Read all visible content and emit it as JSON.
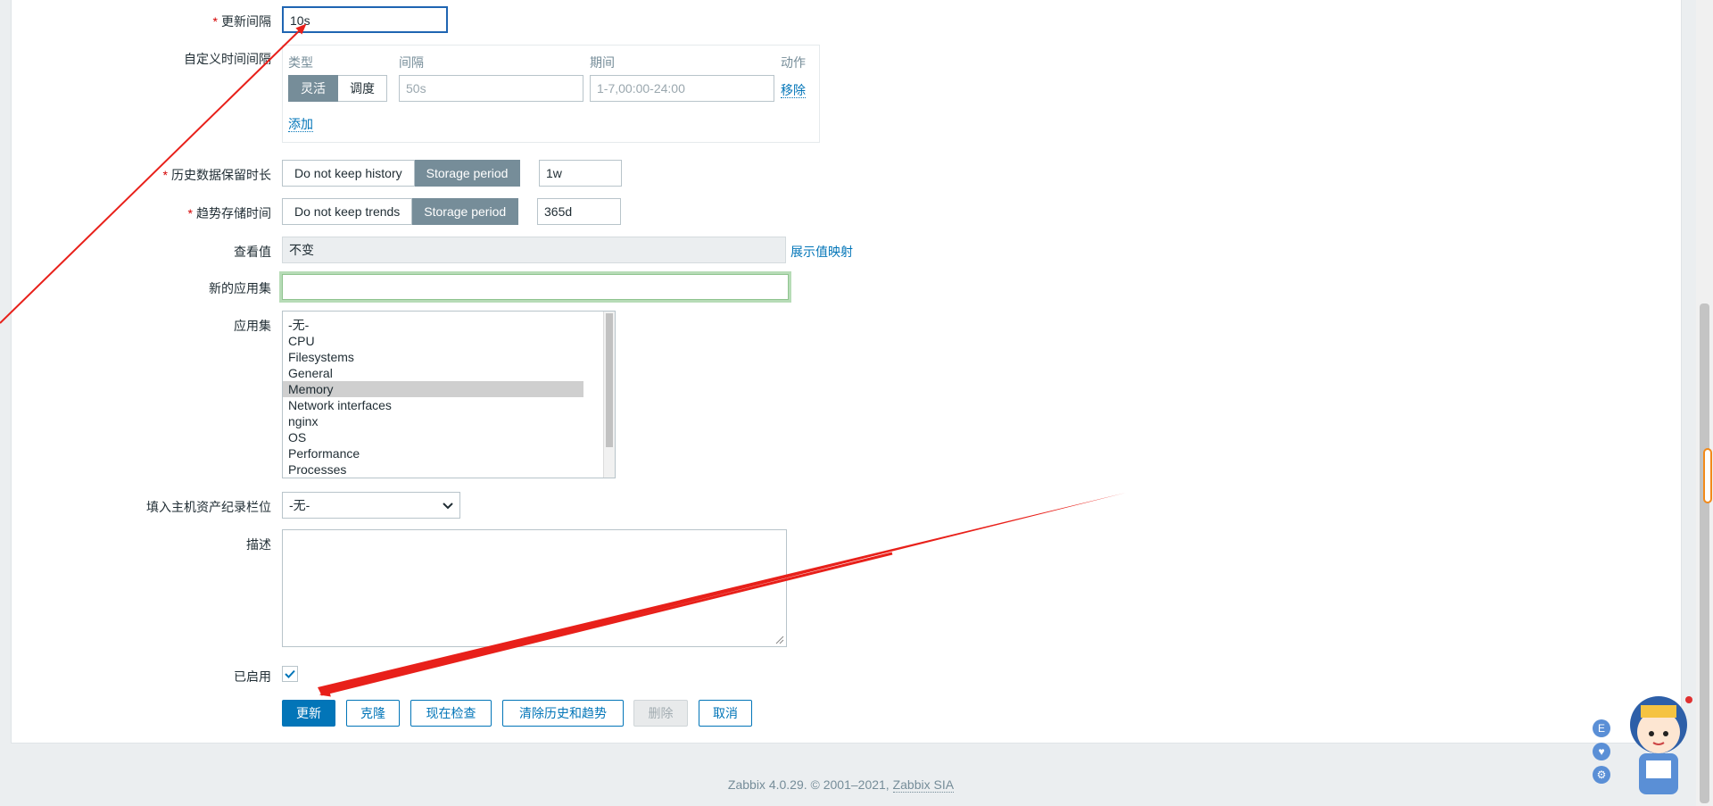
{
  "form": {
    "update_interval": {
      "label": "更新间隔",
      "value": "10s"
    },
    "custom_intervals": {
      "label": "自定义时间间隔",
      "headers": {
        "type": "类型",
        "interval": "间隔",
        "period": "期间",
        "action": "动作"
      },
      "type_options": [
        "灵活",
        "调度"
      ],
      "interval_placeholder": "50s",
      "period_placeholder": "1-7,00:00-24:00",
      "remove_label": "移除",
      "add_label": "添加"
    },
    "history": {
      "label": "历史数据保留时长",
      "options": [
        "Do not keep history",
        "Storage period"
      ],
      "value": "1w"
    },
    "trends": {
      "label": "趋势存储时间",
      "options": [
        "Do not keep trends",
        "Storage period"
      ],
      "value": "365d"
    },
    "show_value": {
      "label": "查看值",
      "value": "不变",
      "link": "展示值映射"
    },
    "new_application": {
      "label": "新的应用集",
      "value": ""
    },
    "applications": {
      "label": "应用集",
      "items": [
        "-无-",
        "CPU",
        "Filesystems",
        "General",
        "Memory",
        "Network interfaces",
        "nginx",
        "OS",
        "Performance",
        "Processes"
      ],
      "selected": "Memory"
    },
    "inventory": {
      "label": "填入主机资产纪录栏位",
      "value": "-无-"
    },
    "description": {
      "label": "描述",
      "value": ""
    },
    "enabled": {
      "label": "已启用",
      "checked": true
    }
  },
  "buttons": {
    "update": "更新",
    "clone": "克隆",
    "check_now": "现在检查",
    "clear": "清除历史和趋势",
    "delete": "删除",
    "cancel": "取消"
  },
  "footer": {
    "text": "Zabbix 4.0.29. © 2001–2021, ",
    "link": "Zabbix SIA"
  },
  "assistant": {
    "icons": [
      "E",
      "shirt-icon",
      "gear-icon"
    ]
  },
  "colors": {
    "accent": "#0275b8",
    "toggle_active": "#768d99",
    "annotation_arrow": "#e8201a",
    "required": "#d40000"
  }
}
